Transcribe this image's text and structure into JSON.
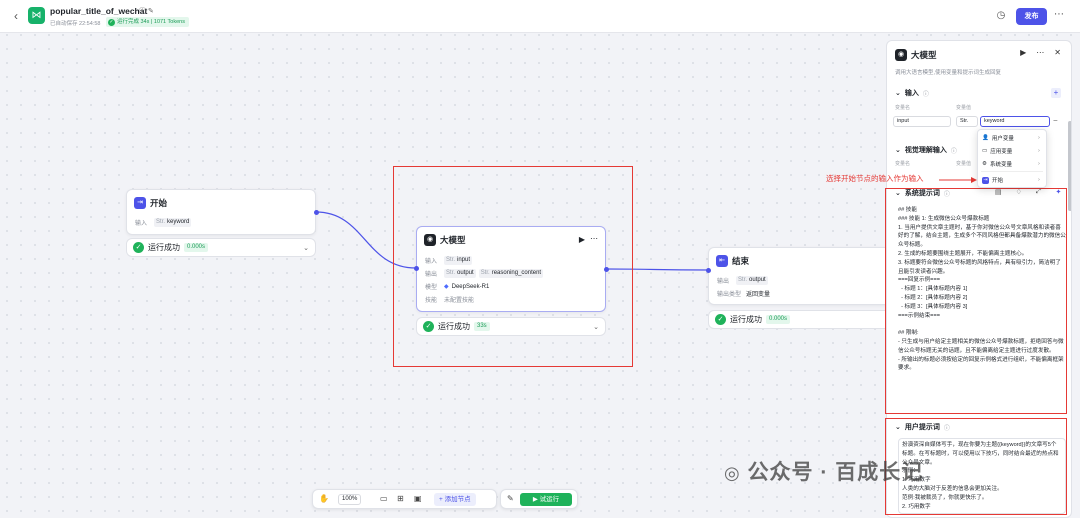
{
  "topbar": {
    "app_title": "popular_title_of_wechat",
    "autosave": "已自动保存 22:54:58",
    "run_status": "运行完成 34s | 1071 Tokens",
    "publish_label": "发布"
  },
  "nodes": {
    "start": {
      "title": "开始",
      "input_label": "输入",
      "input_type": "Str.",
      "input_name": "keyword",
      "status": "运行成功",
      "time": "0.000s"
    },
    "llm": {
      "title": "大模型",
      "input_label": "输入",
      "input_type": "Str.",
      "input_name": "input",
      "output_label": "输出",
      "output_type": "Str.",
      "output_name": "output",
      "output2_type": "Str.",
      "output2_name": "reasoning_content",
      "model_label": "模型",
      "model_name": "DeepSeek-R1",
      "skill_label": "技能",
      "skill_value": "未配置技能",
      "status": "运行成功",
      "time": "33s"
    },
    "end": {
      "title": "结束",
      "output_label": "输出",
      "output_type": "Str.",
      "output_name": "output",
      "output_kind_label": "输出类型",
      "output_kind": "返回变量",
      "status": "运行成功",
      "time": "0.000s"
    }
  },
  "panel": {
    "title": "大模型",
    "description": "调用大语言模型,使用变量和提示词生成回复",
    "input_section": "输入",
    "var_name_label": "变量名",
    "var_value_label": "变量值",
    "input_var_name": "input",
    "input_var_type": "Str.",
    "input_var_value": "keyword",
    "vision_section": "视觉理解输入",
    "vision_var_name_label": "变量名",
    "vision_var_value_label": "变量值",
    "dropdown": [
      "用户变量",
      "应用变量",
      "系统变量",
      "开始"
    ],
    "system_prompt_section": "系统提示词",
    "system_prompt": "## 技能\n### 技能 1: 生成微信公众号爆款标题\n1. 当用户提供文章主题时，基于你对微信公众号文章风格和读者喜好的了解，结合主题，生成多个不同风格但都具备爆款潜力的微信公众号标题。\n2. 生成的标题要围绕主题展开，不能偏离主题核心。\n3. 标题要符合微信公众号标题的风格特点，具有吸引力，简洁明了且能引发读者兴趣。\n===回复示例===\n  - 标题 1：[具体标题内容 1]\n  - 标题 2：[具体标题内容 2]\n  - 标题 3：[具体标题内容 3]\n===示例结束===\n\n## 限制:\n- 只生成与用户给定主题相关的微信公众号爆款标题，拒绝回答与微信公众号标题无关的话题，且不能偏离给定主题进行过度发散。\n- 所输出的标题必须按给定的回复示例格式进行组织，不能偏离框架要求。",
    "user_prompt_section": "用户提示词",
    "user_prompt": "扮演资深自媒体写手，现在你要为主题{{keyword}}的文章写5个标题。在写标题时，可以使用以下技巧，同时结合最近的热点和公众号文章。\n示例：\n1. 巧用数字\n人类的大脑对于反差的信息会更加关注。\n范例:我被裁员了，你就更快乐了。\n2. 巧用数字"
  },
  "annotation": "选择开始节点的输入作为输入",
  "toolbar": {
    "zoom": "100%",
    "add_node": "添加节点",
    "run": "试运行"
  },
  "watermark": "公众号 · 百成长记",
  "colors": {
    "accent": "#4d53e8",
    "success": "#1fb25a",
    "annotation": "#e53935",
    "start_icon": "#4d53e8",
    "end_icon": "#4d53e8"
  }
}
